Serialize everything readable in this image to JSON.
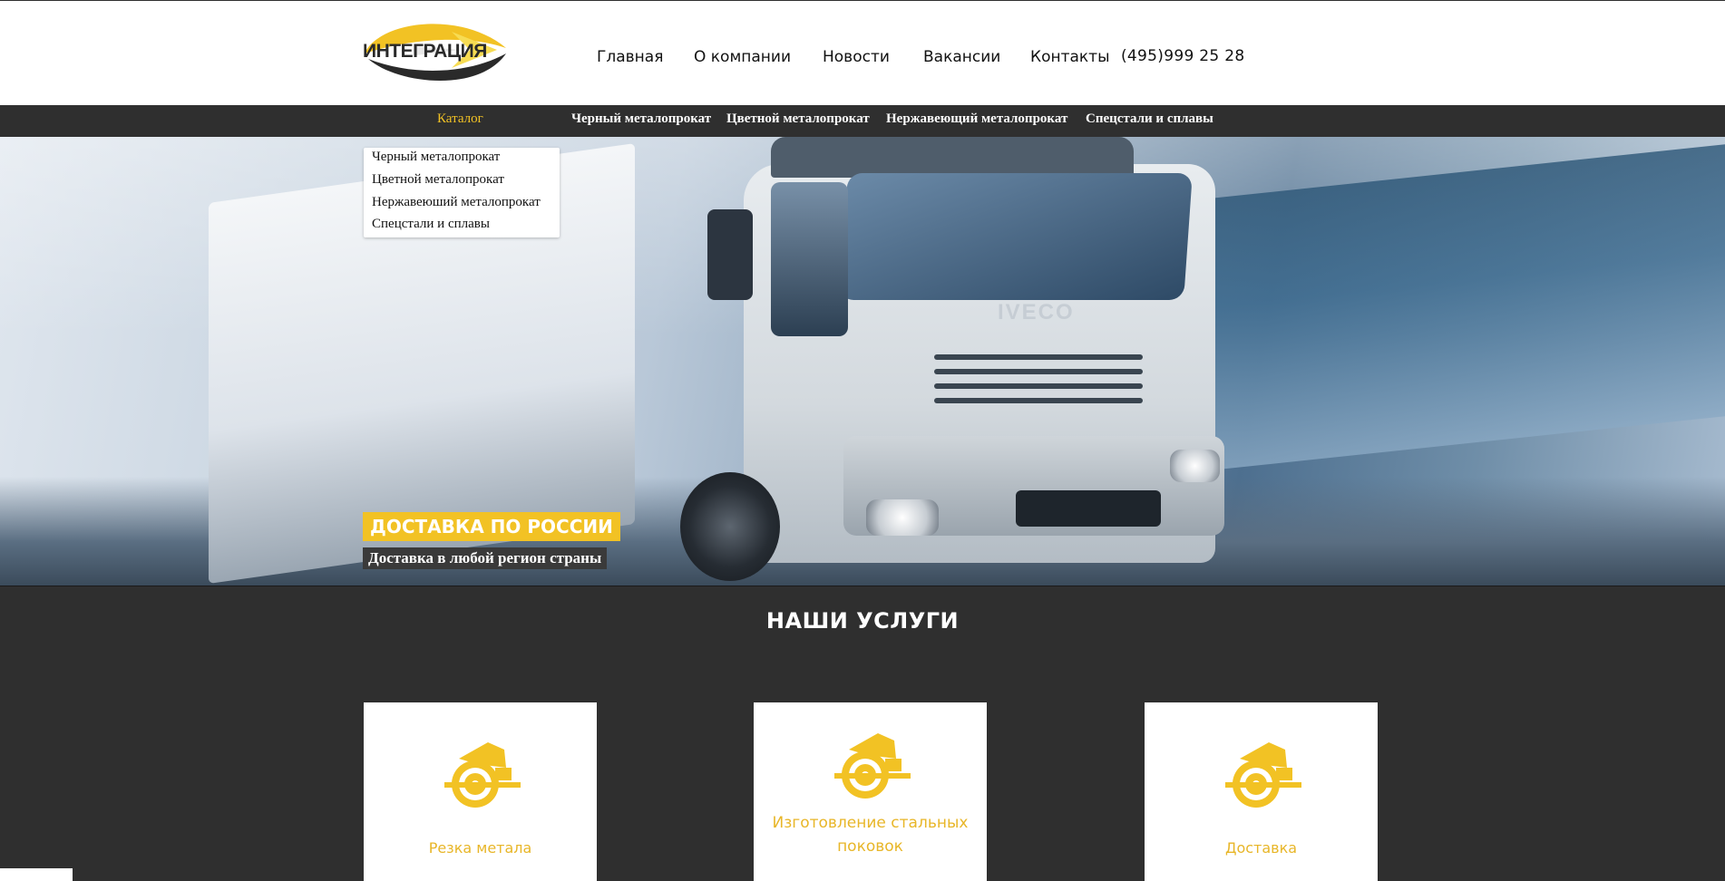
{
  "header": {
    "logo_text": "ИНТЕГРАЦИЯ",
    "nav": [
      "Главная",
      "О компании",
      "Новости",
      "Вакансии",
      "Контакты"
    ],
    "phone": "(495)999 25 28"
  },
  "catalog_bar": {
    "title": "Каталог",
    "items": [
      "Черный металопрокат",
      "Цветной металопрокат",
      "Нержавеющий металопрокат",
      "Спецстали и сплавы"
    ]
  },
  "dropdown": {
    "items": [
      "Черный металопрокат",
      "Цветной металопрокат",
      "Нержавеюший металопрокат",
      "Спецстали и сплавы"
    ]
  },
  "hero": {
    "headline": "ДОСТАВКА ПО РОССИИ",
    "subline": "Доставка в любой регион страны",
    "truck_brand": "IVECO"
  },
  "services": {
    "title": "НАШИ УСЛУГИ",
    "cards": [
      {
        "label": "Резка метала",
        "icon": "circular-saw-icon"
      },
      {
        "label": "Изготовление стальных поковок",
        "icon": "circular-saw-icon"
      },
      {
        "label": "Доставка",
        "icon": "circular-saw-icon"
      }
    ]
  },
  "colors": {
    "accent": "#f2c224",
    "dark_bar": "#2f2f2f",
    "card_text": "#e8b628"
  }
}
